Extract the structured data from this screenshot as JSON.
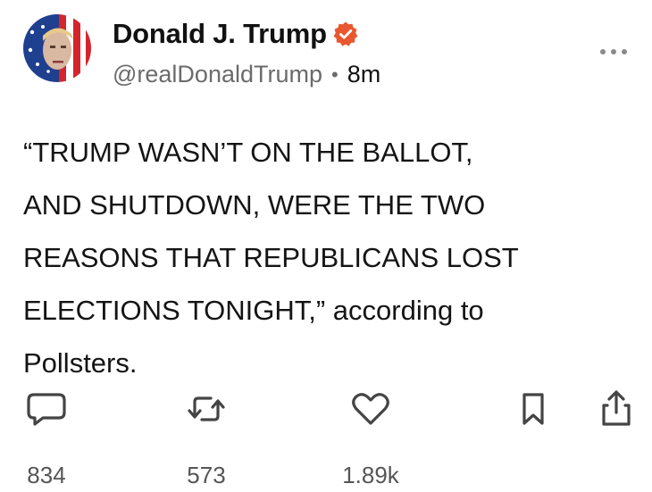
{
  "author": {
    "display_name": "Donald J. Trump",
    "handle": "@realDonaldTrump",
    "separator": "•",
    "time_ago": "8m",
    "verified": true,
    "verified_color": "#e8572f"
  },
  "post": {
    "text": "“TRUMP WASN’T ON THE BALLOT,\nAND SHUTDOWN, WERE THE TWO\nREASONS THAT REPUBLICANS LOST\nELECTIONS TONIGHT,” according to\nPollsters."
  },
  "actions": {
    "replies": "834",
    "reposts": "573",
    "likes": "1.89k"
  },
  "icons": {
    "more": "more-horizontal-icon",
    "reply": "comment-icon",
    "repost": "repost-icon",
    "like": "heart-icon",
    "bookmark": "bookmark-icon",
    "share": "share-icon"
  },
  "colors": {
    "text": "#111111",
    "secondary": "#6b6b6b",
    "icon": "#444444"
  }
}
